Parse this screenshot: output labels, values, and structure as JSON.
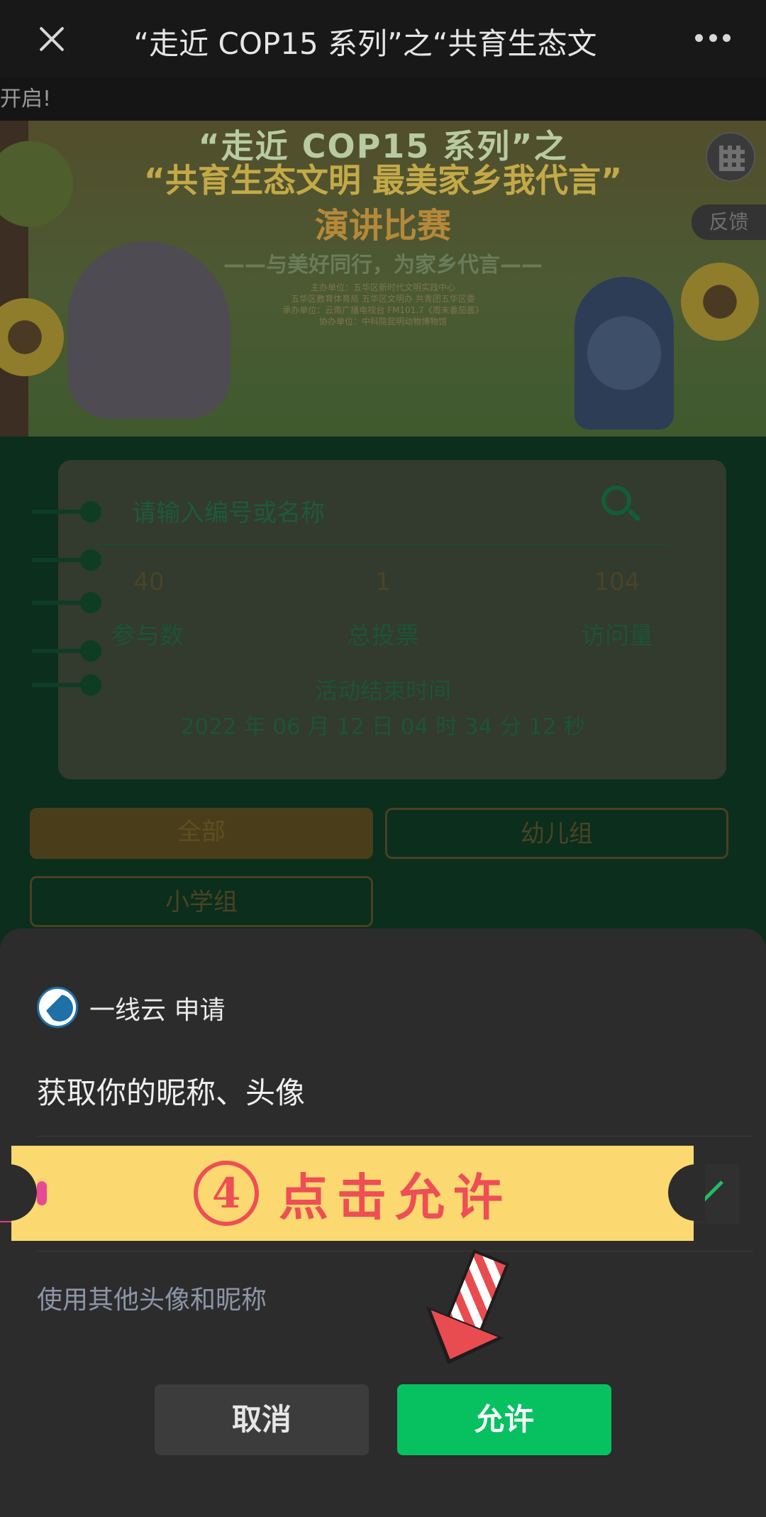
{
  "nav": {
    "title": "“走近 COP15 系列”之“共育生态文"
  },
  "marquee": {
    "text": "开启!"
  },
  "banner": {
    "title_line1": "“走近 COP15 系列”之",
    "title_line2": "“共育生态文明 最美家乡我代言”",
    "title_line3": "演讲比赛",
    "subtitle": "——与美好同行，为家乡代言——",
    "small_lines": [
      "主办单位：五华区新时代文明实践中心",
      "五华区教育体育局    五华区文明办    共青团五华区委",
      "承办单位：云南广播电视台 FM101.7《周末番茄酱》",
      "协办单位：中科院昆明动物博物馆"
    ],
    "feedback_label": "反馈"
  },
  "search": {
    "placeholder": "请输入编号或名称"
  },
  "stats": [
    {
      "value": "40",
      "label": "参与数"
    },
    {
      "value": "1",
      "label": "总投票"
    },
    {
      "value": "104",
      "label": "访问量"
    }
  ],
  "countdown": {
    "label": "活动结束时间",
    "time": "2022 年 06 月 12 日 04 时 34 分 12 秒"
  },
  "filters": {
    "all": "全部",
    "kindergarten": "幼儿组",
    "primary": "小学组"
  },
  "sheet": {
    "app_name": "一线云  申请",
    "request_title": "获取你的昵称、头像",
    "annotation_number": "4",
    "annotation_text": "点击允许",
    "alt_link": "使用其他头像和昵称",
    "cancel_label": "取消",
    "allow_label": "允许"
  },
  "colors": {
    "allow_green": "#07c160",
    "annotation_yellow": "#fcd970",
    "annotation_red": "#ee4e55"
  }
}
